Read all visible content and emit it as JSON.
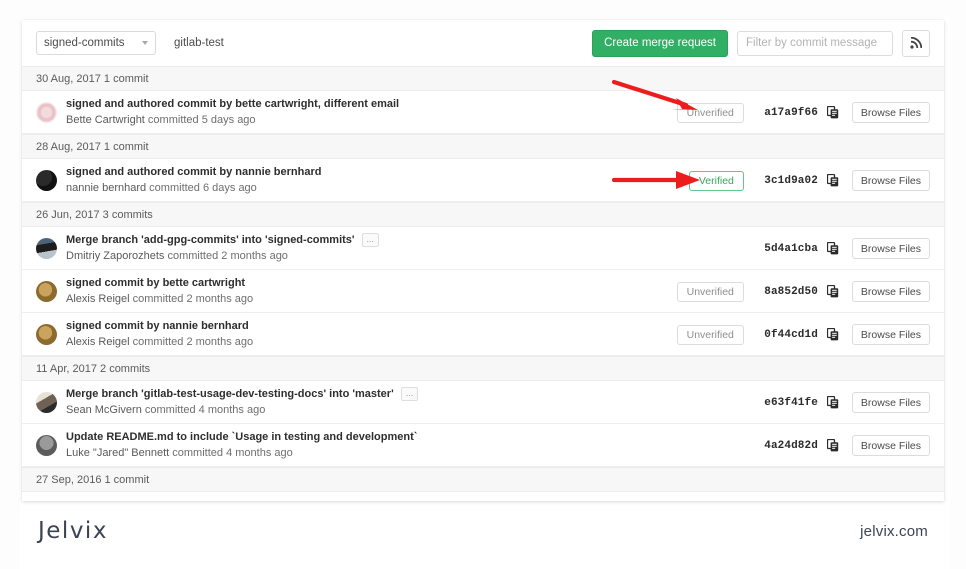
{
  "toolbar": {
    "branch_label": "signed-commits",
    "repo_label": "gitlab-test",
    "create_mr_label": "Create merge request",
    "filter_placeholder": "Filter by commit message",
    "filter_value": "",
    "rss_icon": "rss-icon",
    "caret_icon": "chevron-down-icon"
  },
  "groups": [
    {
      "date_label": "30 Aug, 2017 1 commit",
      "commits": [
        {
          "title": "signed and authored commit by bette cartwright, different email",
          "author": "Bette Cartwright",
          "meta": "committed 5 days ago",
          "badge": "Unverified",
          "badge_state": "unverified",
          "hash": "a17a9f66",
          "browse_label": "Browse Files",
          "has_ellipsis": false,
          "avatar": "identicon-pink"
        }
      ]
    },
    {
      "date_label": "28 Aug, 2017 1 commit",
      "commits": [
        {
          "title": "signed and authored commit by nannie bernhard",
          "author": "nannie bernhard",
          "meta": "committed 6 days ago",
          "badge": "Verified",
          "badge_state": "verified",
          "hash": "3c1d9a02",
          "browse_label": "Browse Files",
          "has_ellipsis": false,
          "avatar": "photo-dark"
        }
      ]
    },
    {
      "date_label": "26 Jun, 2017 3 commits",
      "commits": [
        {
          "title": "Merge branch 'add-gpg-commits' into 'signed-commits'",
          "author": "Dmitriy Zaporozhets",
          "meta": "committed 2 months ago",
          "badge": "",
          "badge_state": "none",
          "hash": "5d4a1cba",
          "browse_label": "Browse Files",
          "has_ellipsis": true,
          "ellipsis_label": "...",
          "avatar": "photo-sunglasses"
        },
        {
          "title": "signed commit by bette cartwright",
          "author": "Alexis Reigel",
          "meta": "committed 2 months ago",
          "badge": "Unverified",
          "badge_state": "unverified",
          "hash": "8a852d50",
          "browse_label": "Browse Files",
          "has_ellipsis": false,
          "avatar": "photo-olive"
        },
        {
          "title": "signed commit by nannie bernhard",
          "author": "Alexis Reigel",
          "meta": "committed 2 months ago",
          "badge": "Unverified",
          "badge_state": "unverified",
          "hash": "0f44cd1d",
          "browse_label": "Browse Files",
          "has_ellipsis": false,
          "avatar": "photo-olive"
        }
      ]
    },
    {
      "date_label": "11 Apr, 2017 2 commits",
      "commits": [
        {
          "title": "Merge branch 'gitlab-test-usage-dev-testing-docs' into 'master'",
          "author": "Sean McGivern",
          "meta": "committed 4 months ago",
          "badge": "",
          "badge_state": "none",
          "hash": "e63f41fe",
          "browse_label": "Browse Files",
          "has_ellipsis": true,
          "ellipsis_label": "...",
          "avatar": "photo-light"
        },
        {
          "title": "Update README.md to include `Usage in testing and development`",
          "author": "Luke \"Jared\" Bennett",
          "meta": "committed 4 months ago",
          "badge": "",
          "badge_state": "none",
          "hash": "4a24d82d",
          "browse_label": "Browse Files",
          "has_ellipsis": false,
          "avatar": "photo-grey"
        }
      ]
    },
    {
      "date_label": "27 Sep, 2016 1 commit",
      "commits": []
    }
  ],
  "annotations": {
    "arrow_color": "#ee1d1d",
    "arrow1_target": "Unverified",
    "arrow2_target": "Verified"
  },
  "footer": {
    "logo_text": "Jelvix",
    "site_text": "jelvix.com"
  },
  "colors": {
    "brand_green": "#31af64",
    "verified_green": "#34a85c",
    "arrow_red": "#ee1d1d",
    "footer_navy": "#3b4356"
  }
}
